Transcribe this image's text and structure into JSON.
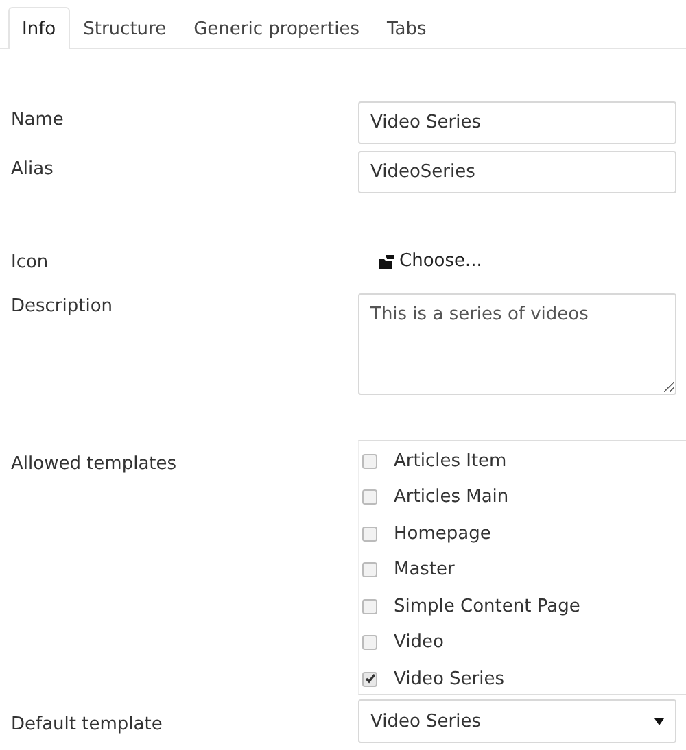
{
  "tabs": [
    {
      "label": "Info",
      "selected": true
    },
    {
      "label": "Structure",
      "selected": false
    },
    {
      "label": "Generic properties",
      "selected": false
    },
    {
      "label": "Tabs",
      "selected": false
    }
  ],
  "name": {
    "label": "Name",
    "value": "Video Series"
  },
  "alias": {
    "label": "Alias",
    "value": "VideoSeries"
  },
  "icon": {
    "label": "Icon",
    "button": "Choose..."
  },
  "description": {
    "label": "Description",
    "value": "This is a series of videos"
  },
  "allowed_templates": {
    "label": "Allowed templates",
    "items": [
      {
        "label": "Articles Item",
        "checked": false
      },
      {
        "label": "Articles Main",
        "checked": false
      },
      {
        "label": "Homepage",
        "checked": false
      },
      {
        "label": "Master",
        "checked": false
      },
      {
        "label": "Simple Content Page",
        "checked": false
      },
      {
        "label": "Video",
        "checked": false
      },
      {
        "label": "Video Series",
        "checked": true
      }
    ]
  },
  "default_template": {
    "label": "Default template",
    "value": "Video Series"
  }
}
